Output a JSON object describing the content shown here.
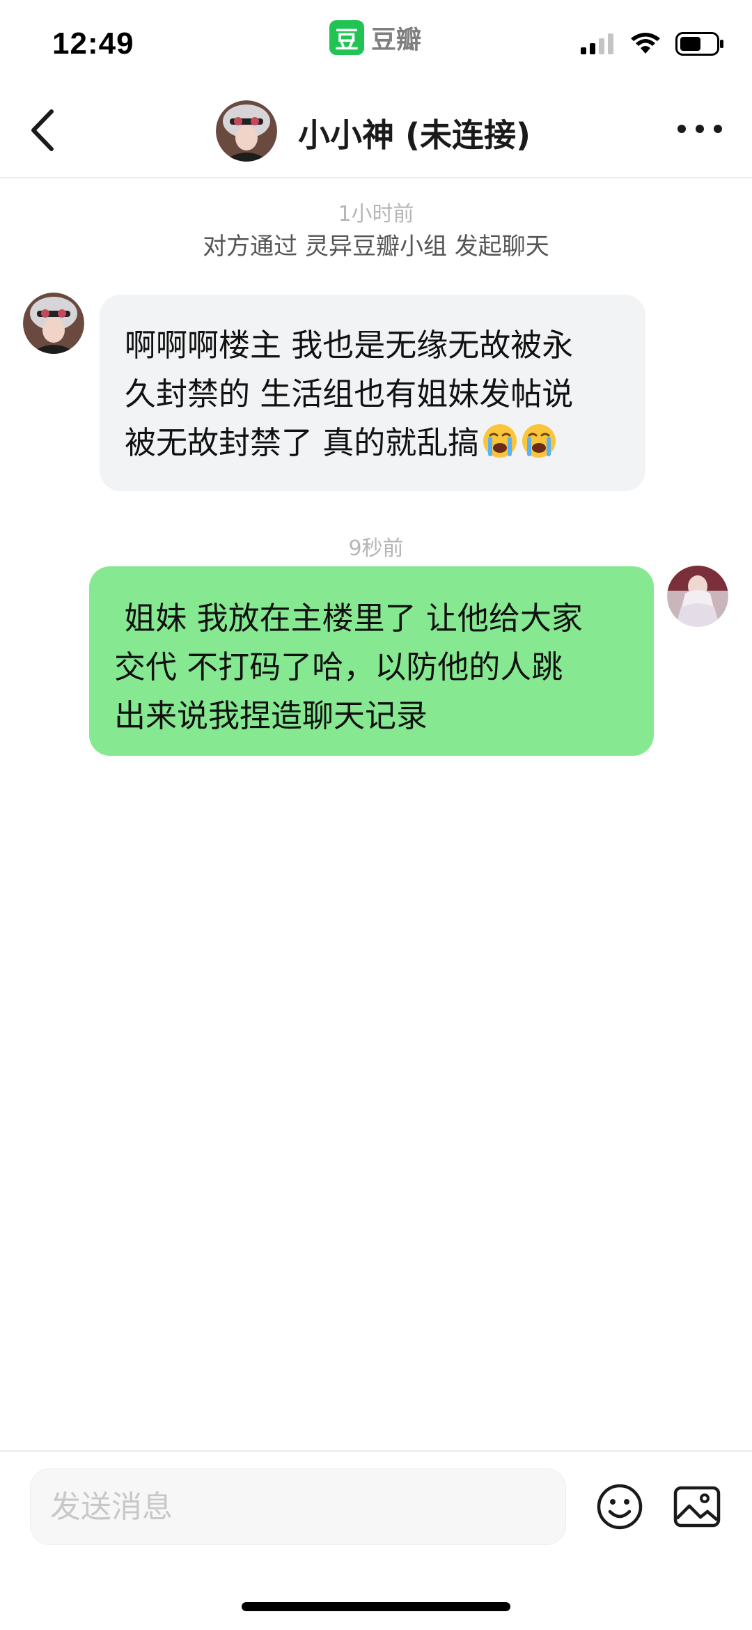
{
  "status_bar": {
    "time": "12:49",
    "app_logo_char": "豆",
    "app_name": "豆瓣",
    "battery_level": 0.6
  },
  "header": {
    "title": "小小神 (未连接)",
    "back_icon": "chevron-left-icon",
    "more_icon": "more-horizontal-icon"
  },
  "chat": {
    "system_time": "1小时前",
    "system_message": "对方通过 灵异豆瓣小组 发起聊天",
    "messages": [
      {
        "direction": "incoming",
        "lines": [
          "啊啊啊楼主 我也是无缘无故被永",
          "久封禁的 生活组也有姐妹发帖说",
          "被无故封禁了 真的就乱搞"
        ],
        "emoji": [
          "loudly-crying-face-icon",
          "loudly-crying-face-icon"
        ]
      },
      {
        "direction": "outgoing",
        "time": "9秒前",
        "lines": [
          " 姐妹 我放在主楼里了 让他给大家",
          "交代 不打码了哈，以防他的人跳",
          "出来说我捏造聊天记录"
        ]
      }
    ]
  },
  "input": {
    "placeholder": "发送消息",
    "emoji_icon": "emoji-smile-icon",
    "image_icon": "image-icon"
  },
  "colors": {
    "incoming_bubble": "#f2f3f5",
    "outgoing_bubble": "#86e991",
    "douban_green": "#21c353"
  }
}
